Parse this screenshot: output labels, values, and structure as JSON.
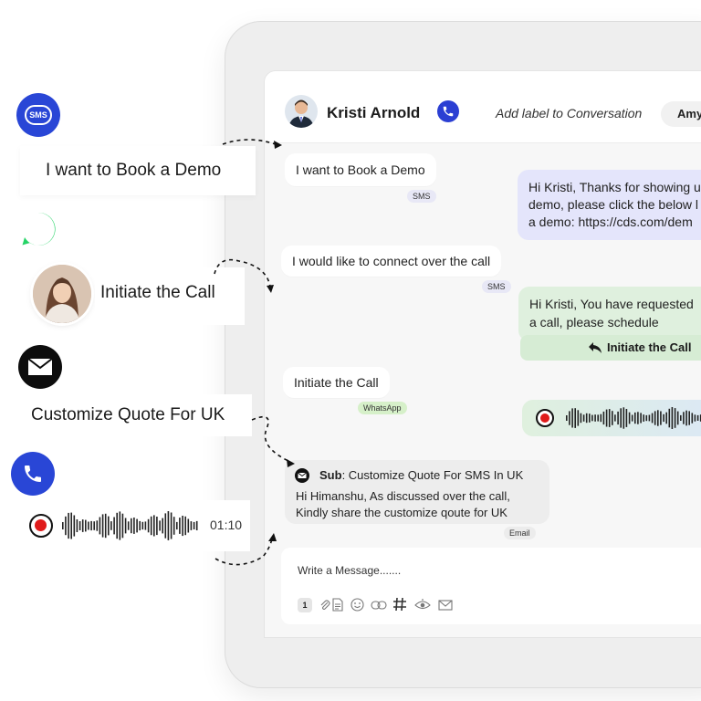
{
  "left_panel": {
    "sms_icon_text": "SMS",
    "book_demo_text": "I want to Book a Demo",
    "initiate_call_text": "Initiate the Call",
    "customize_quote_text": "Customize Quote For UK",
    "recording_duration": "01:10"
  },
  "chat": {
    "contact_name": "Kristi Arnold",
    "add_label": "Add label to Conversation",
    "assignee": "Amy",
    "messages": [
      {
        "text": "I want to Book a Demo",
        "channel": "SMS"
      },
      {
        "lines": [
          "Hi Kristi, Thanks for showing u",
          "demo, please click the below l",
          "a demo: https://cds.com/dem"
        ]
      },
      {
        "text": "I would like to connect over the call",
        "channel": "SMS"
      },
      {
        "lines": [
          "Hi Kristi, You have requested",
          "a call, please schedule"
        ],
        "action": "Initiate the Call"
      },
      {
        "text": "Initiate the Call",
        "channel": "WhatsApp"
      },
      {
        "type": "voice"
      },
      {
        "subject_label": "Sub",
        "subject": ": Customize Quote For SMS In UK",
        "lines": [
          "Hi Himanshu, As discussed over the call,",
          "Kindly share the customize qoute for UK"
        ],
        "channel": "Email"
      }
    ],
    "compose_placeholder": "Write a Message.......",
    "compose_badge": "1"
  },
  "colors": {
    "accent_blue": "#2b3fd3",
    "whatsapp_green": "#25d366",
    "record_red": "#e01b1b",
    "bubble_purple": "#e4e5fb",
    "bubble_green": "#dff0de"
  }
}
